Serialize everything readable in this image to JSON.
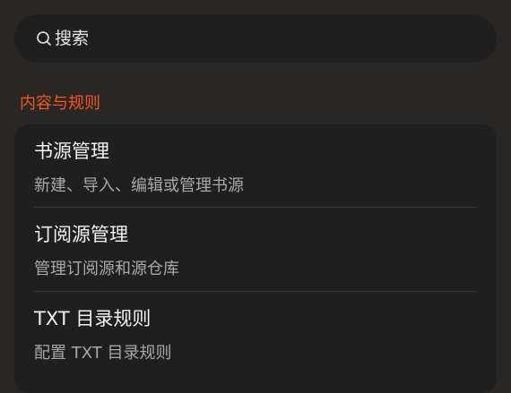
{
  "search": {
    "placeholder": "搜索",
    "icon": "search-icon"
  },
  "section": {
    "title": "内容与规则"
  },
  "items": [
    {
      "title": "书源管理",
      "desc": "新建、导入、编辑或管理书源"
    },
    {
      "title": "订阅源管理",
      "desc": "管理订阅源和源仓库"
    },
    {
      "title": "TXT 目录规则",
      "desc": "配置 TXT 目录规则"
    }
  ],
  "colors": {
    "background": "#2a2623",
    "card": "#1f1f1f",
    "accent": "#f0581f",
    "title_text": "#f2f2f2",
    "desc_text": "#a9a9a9"
  }
}
